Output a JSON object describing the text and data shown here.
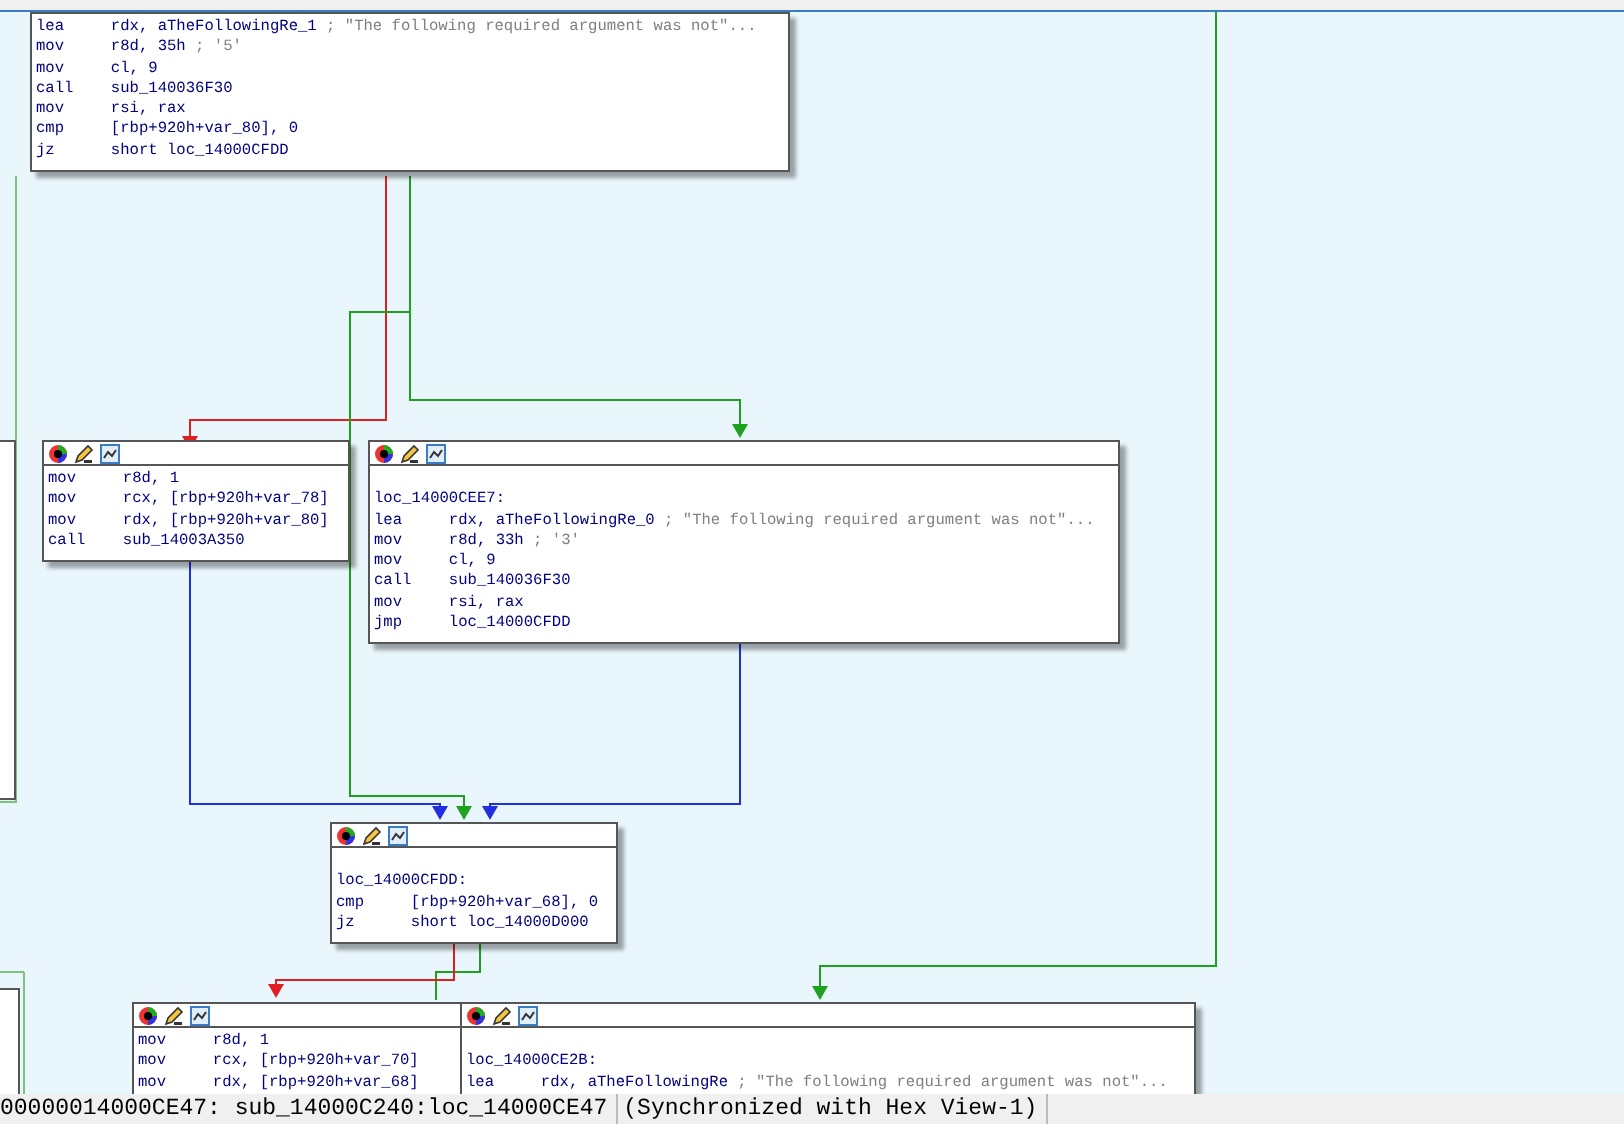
{
  "graph": {
    "nodes": [
      {
        "lines": [
          {
            "op": "lea",
            "args": "rdx, aTheFollowingRe_1",
            "comment": "; \"The following required argument was not\"..."
          },
          {
            "op": "mov",
            "args": "r8d, 35h",
            "comment": "; '5'"
          },
          {
            "op": "mov",
            "args": "cl, 9"
          },
          {
            "op": "call",
            "args": "sub_140036F30"
          },
          {
            "op": "mov",
            "args": "rsi, rax"
          },
          {
            "op": "cmp",
            "args": "[rbp+920h+var_80], 0"
          },
          {
            "op": "jz",
            "args": "short loc_14000CFDD"
          }
        ]
      },
      {
        "lines": [
          {
            "op": "mov",
            "args": "r8d, 1"
          },
          {
            "op": "mov",
            "args": "rcx, [rbp+920h+var_78]"
          },
          {
            "op": "mov",
            "args": "rdx, [rbp+920h+var_80]"
          },
          {
            "op": "call",
            "args": "sub_14003A350"
          }
        ]
      },
      {
        "label": "loc_14000CEE7:",
        "lines": [
          {
            "op": "lea",
            "args": "rdx, aTheFollowingRe_0",
            "comment": "; \"The following required argument was not\"..."
          },
          {
            "op": "mov",
            "args": "r8d, 33h",
            "comment": "; '3'"
          },
          {
            "op": "mov",
            "args": "cl, 9"
          },
          {
            "op": "call",
            "args": "sub_140036F30"
          },
          {
            "op": "mov",
            "args": "rsi, rax"
          },
          {
            "op": "jmp",
            "args": "loc_14000CFDD"
          }
        ]
      },
      {
        "label": "loc_14000CFDD:",
        "lines": [
          {
            "op": "cmp",
            "args": "[rbp+920h+var_68], 0"
          },
          {
            "op": "jz",
            "args": "short loc_14000D000"
          }
        ]
      },
      {
        "lines": [
          {
            "op": "mov",
            "args": "r8d, 1"
          },
          {
            "op": "mov",
            "args": "rcx, [rbp+920h+var_70]"
          },
          {
            "op": "mov",
            "args": "rdx, [rbp+920h+var_68]"
          }
        ]
      },
      {
        "label": "loc_14000CE2B:",
        "lines": [
          {
            "op": "lea",
            "args": "rdx, aTheFollowingRe",
            "comment": "; \"The following required argument was not\"..."
          }
        ]
      }
    ]
  },
  "status_bar": {
    "location": "00000014000CE47: sub_14000C240:loc_14000CE47",
    "sync": "(Synchronized with Hex View-1)"
  }
}
